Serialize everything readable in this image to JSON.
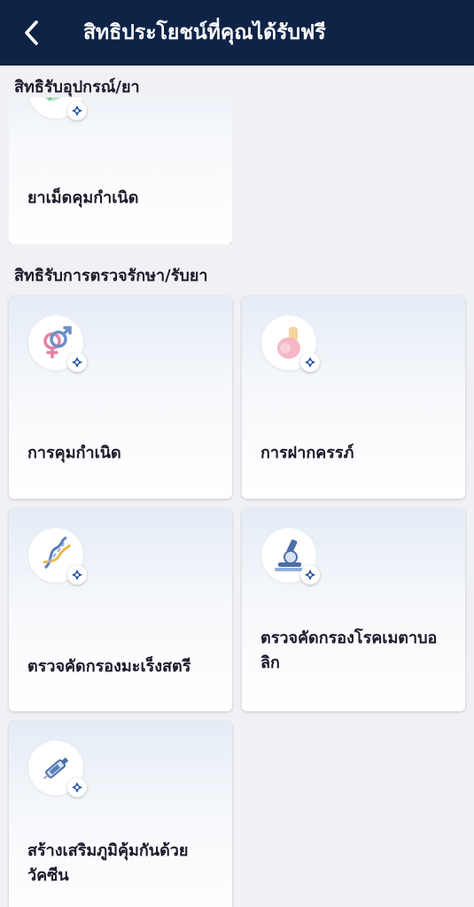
{
  "header": {
    "title": "สิทธิประโยชน์ที่คุณได้รับฟรี",
    "back_icon": "chevron-left-icon"
  },
  "sections": [
    {
      "title": "สิทธิรับอุปกรณ์/ยา",
      "cards": [
        {
          "label": "ยาเม็ดคุมกำเนิด",
          "icon": "pill-icon"
        }
      ]
    },
    {
      "title": "สิทธิรับการตรวจรักษา/รับยา",
      "cards": [
        {
          "label": "การคุมกำเนิด",
          "icon": "gender-symbols-icon"
        },
        {
          "label": "การฝากครรภ์",
          "icon": "pregnant-woman-icon"
        },
        {
          "label": "ตรวจคัดกรองมะเร็งสตรี",
          "icon": "dna-icon"
        },
        {
          "label": "ตรวจคัดกรองโรคเมตาบอลิก",
          "icon": "microscope-icon"
        },
        {
          "label": "สร้างเสริมภูมิคุ้มกันด้วยวัคซีน",
          "icon": "syringe-icon"
        }
      ]
    }
  ],
  "colors": {
    "header_bg": "#0f2347",
    "page_bg": "#f0f1f5",
    "badge_icon": "#1f4f9e"
  }
}
